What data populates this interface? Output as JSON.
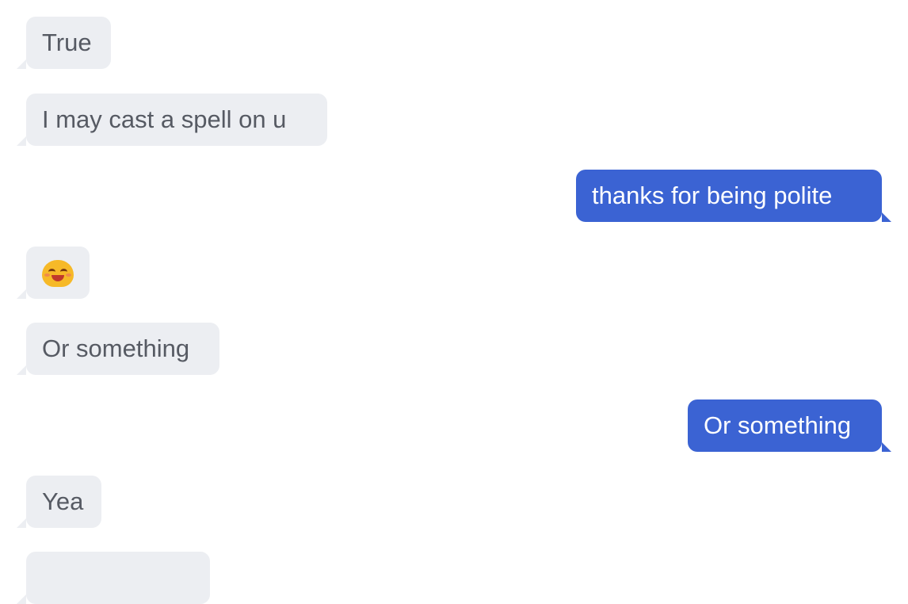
{
  "messages": [
    {
      "direction": "incoming",
      "text": "True"
    },
    {
      "direction": "incoming",
      "text": "I may cast a spell on u"
    },
    {
      "direction": "outgoing",
      "text": "thanks for being polite"
    },
    {
      "direction": "incoming",
      "emoji": "smiling-face-emoji"
    },
    {
      "direction": "incoming",
      "text": "Or something"
    },
    {
      "direction": "outgoing",
      "text": "Or something"
    },
    {
      "direction": "incoming",
      "text": "Yea"
    },
    {
      "direction": "incoming",
      "text": ""
    }
  ],
  "colors": {
    "incoming_bubble": "#eceef2",
    "incoming_text": "#565a63",
    "outgoing_bubble": "#3b63d3",
    "outgoing_text": "#ffffff",
    "emoji_face": "#f6b928"
  }
}
